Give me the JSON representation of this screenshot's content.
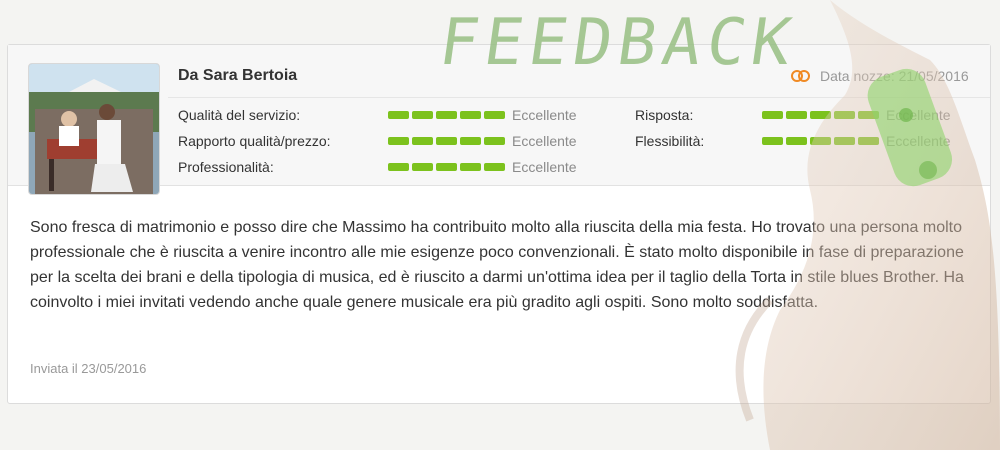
{
  "overlay_title": "FEEDBACK",
  "review": {
    "reviewer": "Da Sara Bertoia",
    "wedding_date": "Data nozze: 21/05/2016",
    "ratings_left": [
      {
        "label": "Qualità del servizio:",
        "value": "Eccellente",
        "score": 5
      },
      {
        "label": "Rapporto qualità/prezzo:",
        "value": "Eccellente",
        "score": 5
      },
      {
        "label": "Professionalità:",
        "value": "Eccellente",
        "score": 5
      }
    ],
    "ratings_right": [
      {
        "label": "Risposta:",
        "value": "Eccellente",
        "score": 5
      },
      {
        "label": "Flessibilità:",
        "value": "Eccellente",
        "score": 5
      }
    ],
    "text": "Sono fresca di matrimonio e posso dire che Massimo ha contribuito molto alla riuscita della mia festa. Ho trovato una persona molto professionale che è riuscita a venire incontro alle mie esigenze poco convenzionali. È stato molto disponibile in fase di preparazione per la scelta dei brani e della tipologia di musica, ed è riuscito a darmi un'ottima idea per il taglio della Torta in stile blues Brother. Ha coinvolto i miei invitati vedendo anche quale genere musicale era più gradito agli ospiti. Sono molto soddisfatta.",
    "sent": "Inviata il 23/05/2016"
  },
  "colors": {
    "rating_bar": "#7cc21d",
    "ring_icon": "#f08a24",
    "title_green": "#96be82"
  }
}
